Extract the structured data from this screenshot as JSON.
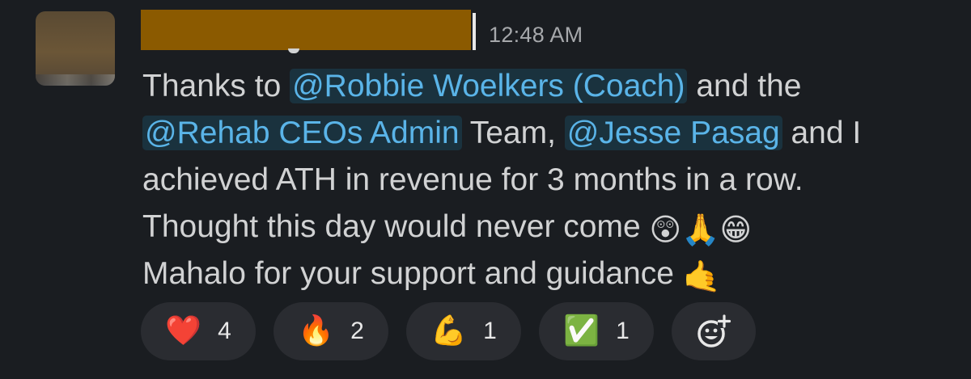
{
  "message": {
    "timestamp": "12:48 AM",
    "line1": {
      "t1": "Thanks to ",
      "mention1": "@Robbie Woelkers (Coach)",
      "t2": " and the"
    },
    "line2": {
      "mention2": "@Rehab CEOs Admin",
      "t3": " Team, ",
      "mention3": "@Jesse Pasag",
      "t4": " and I"
    },
    "line3": "achieved ATH in revenue for 3 months in a row.",
    "line4": {
      "text": "Thought this day would never come ",
      "emoji1": "😲",
      "emoji2": "🙏",
      "emoji3": "😁"
    },
    "line5": {
      "text": "Mahalo for your support and guidance ",
      "emoji": "🤙"
    }
  },
  "reactions": [
    {
      "emoji": "❤️",
      "count": "4",
      "icon": "heart-icon"
    },
    {
      "emoji": "🔥",
      "count": "2",
      "icon": "fire-icon"
    },
    {
      "emoji": "💪",
      "count": "1",
      "icon": "flexed-biceps-icon"
    },
    {
      "emoji": "✅",
      "count": "1",
      "icon": "check-mark-icon"
    }
  ],
  "colors": {
    "background": "#1a1d21",
    "text": "#d1d2d3",
    "mention": "#5ab4e8",
    "reaction_pill": "#2a2c31",
    "redaction": "#8b5a00"
  }
}
